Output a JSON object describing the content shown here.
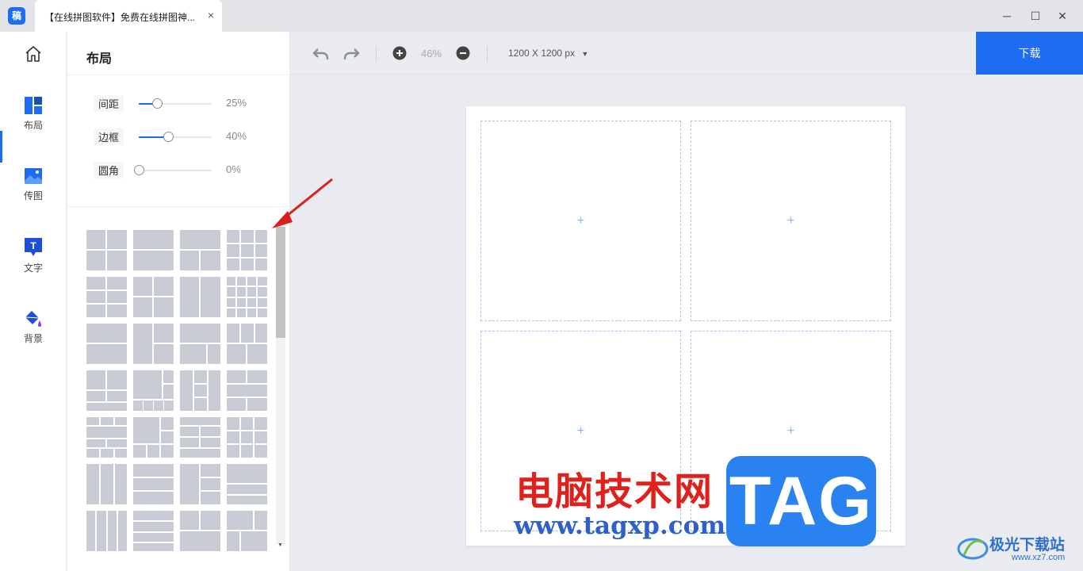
{
  "window": {
    "app_icon_text": "稿",
    "tab_title": "【在线拼图软件】免费在线拼图神...",
    "tab_close": "×",
    "minimize": "─",
    "maximize": "☐",
    "close": "✕"
  },
  "nav": {
    "items": [
      {
        "label": "布局",
        "icon": "layout-icon",
        "active": true
      },
      {
        "label": "传图",
        "icon": "image-upload-icon"
      },
      {
        "label": "文字",
        "icon": "text-icon"
      },
      {
        "label": "背景",
        "icon": "paint-bucket-icon"
      }
    ],
    "home_icon": "home-icon"
  },
  "panel": {
    "title": "布局",
    "sliders": [
      {
        "label": "间距",
        "value": "25%",
        "level": 0.25
      },
      {
        "label": "边框",
        "value": "40%",
        "level": 0.4
      },
      {
        "label": "圆角",
        "value": "0%",
        "level": 0.0
      }
    ]
  },
  "toolbar": {
    "zoom": "46%",
    "canvas_size": "1200 X 1200 px",
    "download": "下载"
  },
  "canvas": {
    "cells": [
      {
        "plus": "+"
      },
      {
        "plus": "+"
      },
      {
        "plus": "+"
      },
      {
        "plus": "+"
      }
    ]
  },
  "watermark": {
    "site_cn": "电脑技术网",
    "site_url": "www.tagxp.com",
    "tag": "TAG",
    "logo_text": "极光下载站",
    "logo_url": "www.xz7.com"
  },
  "colors": {
    "accent": "#1e6cf2",
    "thumb_fill": "#c9ccd4",
    "dashed_border": "#a9c6ef"
  }
}
